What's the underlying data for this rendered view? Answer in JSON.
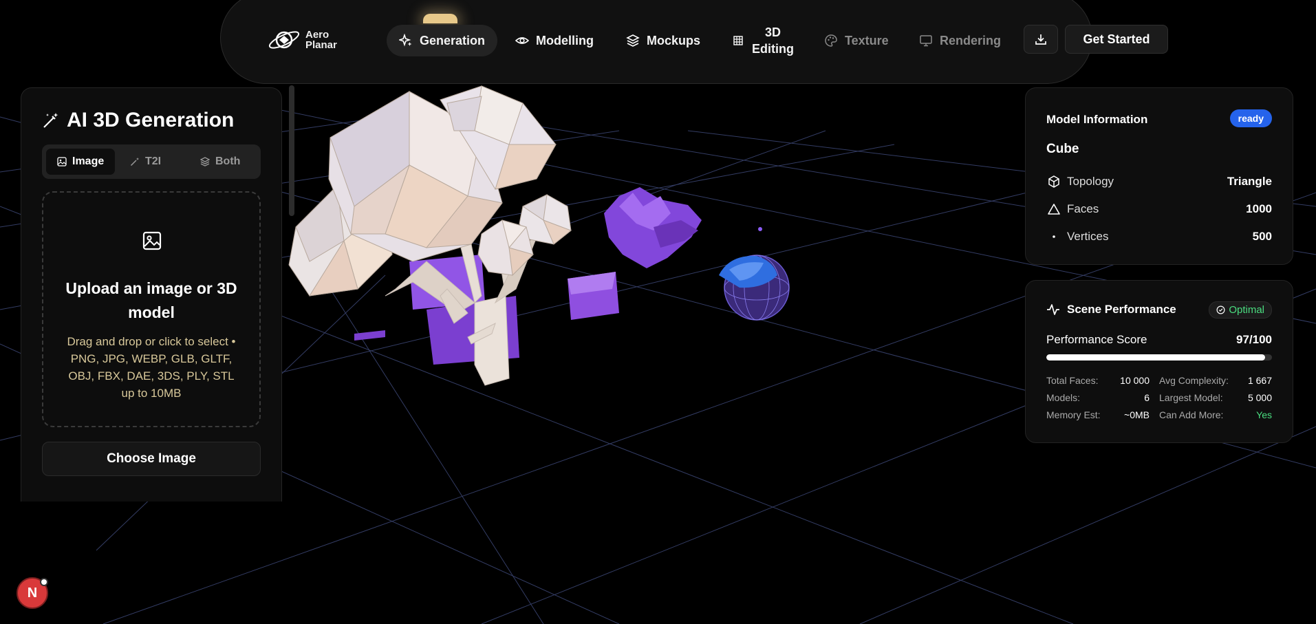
{
  "brand": {
    "name_line1": "Aero",
    "name_line2": "Planar"
  },
  "nav": {
    "generation": "Generation",
    "modelling": "Modelling",
    "mockups": "Mockups",
    "editing_line1": "3D",
    "editing_line2": "Editing",
    "texture": "Texture",
    "rendering": "Rendering",
    "cta": "Get Started"
  },
  "left_panel": {
    "title": "AI 3D Generation",
    "modes": [
      "Image",
      "T2I",
      "Both"
    ],
    "active_mode": "Image",
    "dropzone": {
      "title": "Upload an image or 3D model",
      "description": "Drag and drop or click to select • PNG, JPG, WEBP, GLB, GLTF, OBJ, FBX, DAE, 3DS, PLY, STL up to 10MB"
    },
    "choose_button": "Choose Image"
  },
  "model_info": {
    "heading": "Model Information",
    "status": "ready",
    "name": "Cube",
    "rows": [
      {
        "label": "Topology",
        "value": "Triangle"
      },
      {
        "label": "Faces",
        "value": "1000"
      },
      {
        "label": "Vertices",
        "value": "500"
      }
    ]
  },
  "performance": {
    "heading": "Scene Performance",
    "badge": "Optimal",
    "score_label": "Performance Score",
    "score_value": "97/100",
    "score_fraction": 0.97,
    "stats": [
      {
        "label": "Total Faces:",
        "value": "10 000"
      },
      {
        "label": "Avg Complexity:",
        "value": "1 667"
      },
      {
        "label": "Models:",
        "value": "6"
      },
      {
        "label": "Largest Model:",
        "value": "5 000"
      },
      {
        "label": "Memory Est:",
        "value": "~0MB"
      },
      {
        "label": "Can Add More:",
        "value": "Yes"
      }
    ]
  },
  "user": {
    "initial": "N"
  },
  "colors": {
    "accent_blue": "#2563eb",
    "success_green": "#4ade80",
    "upload_hint": "#d8c89a",
    "grid_line": "#3a4470",
    "model_purple": "#8b4bdf"
  }
}
